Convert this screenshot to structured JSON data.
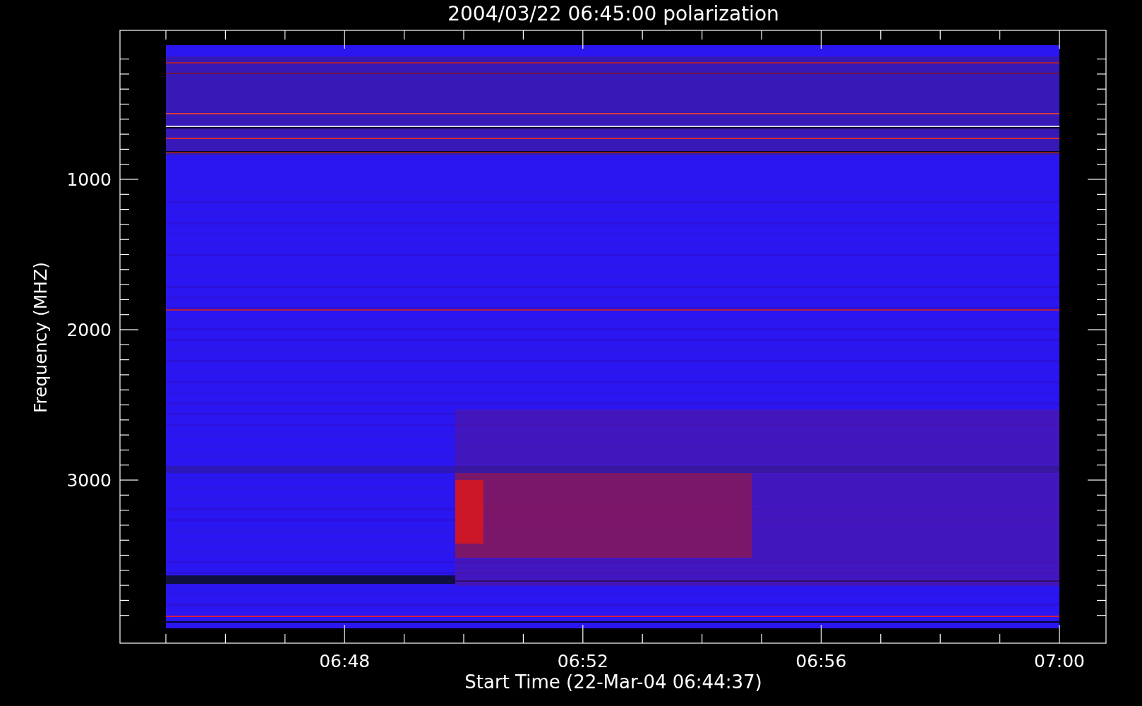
{
  "title": "2004/03/22 06:45:00 polarization",
  "y_axis": {
    "label": "Frequency (MHZ)",
    "ticks": [
      "1000",
      "2000",
      "3000"
    ]
  },
  "x_axis": {
    "label": "Start Time (22-Mar-04 06:44:37)",
    "ticks": [
      "06:48",
      "06:52",
      "06:56",
      "07:00"
    ]
  }
}
